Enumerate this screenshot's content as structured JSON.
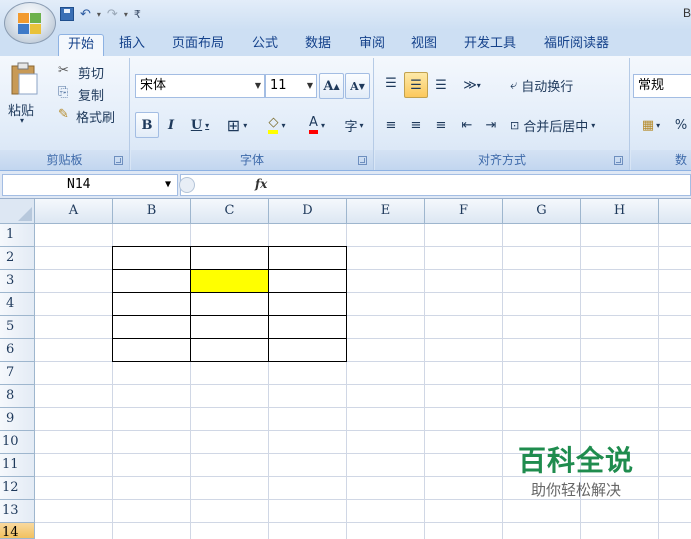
{
  "window": {
    "title_fragment": "B"
  },
  "ribbon_tabs": [
    "开始",
    "插入",
    "页面布局",
    "公式",
    "数据",
    "审阅",
    "视图",
    "开发工具",
    "福昕阅读器"
  ],
  "clipboard": {
    "paste": "粘贴",
    "cut": "剪切",
    "copy": "复制",
    "format_painter": "格式刷",
    "label": "剪贴板"
  },
  "font": {
    "name": "宋体",
    "size": "11",
    "bold": "B",
    "italic": "I",
    "underline": "U",
    "grow": "A",
    "shrink": "A",
    "label": "字体"
  },
  "alignment": {
    "wrap_text": "自动换行",
    "merge_center": "合并后居中",
    "label": "对齐方式"
  },
  "number": {
    "format": "常规",
    "percent": "%",
    "label": "数"
  },
  "formula_bar": {
    "name_box": "N14",
    "fx": "fx"
  },
  "sheet": {
    "columns": [
      "A",
      "B",
      "C",
      "D",
      "E",
      "F",
      "G",
      "H"
    ],
    "rows": [
      "1",
      "2",
      "3",
      "4",
      "5",
      "6",
      "7",
      "8",
      "9",
      "10",
      "11",
      "12",
      "13",
      "14"
    ],
    "active_row": "14",
    "bordered_range": "B2:D6",
    "highlight_cell": "C3",
    "highlight_color": "#ffff00"
  },
  "watermark": {
    "title": "百科全说",
    "subtitle": "助你轻松解决"
  }
}
